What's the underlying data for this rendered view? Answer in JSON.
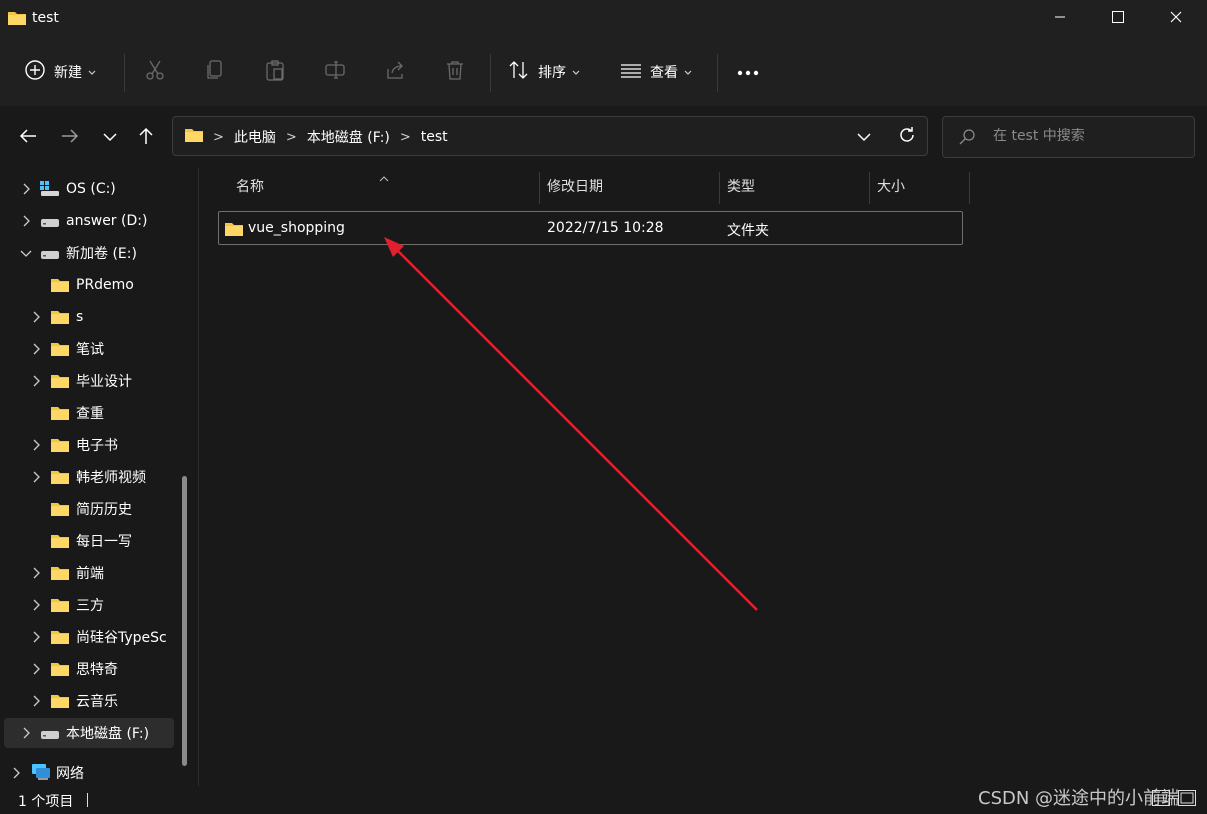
{
  "window": {
    "title": "test",
    "title_icon": "folder-icon"
  },
  "window_controls": {
    "minimize": "minimize-icon",
    "maximize": "maximize-icon",
    "close": "close-icon"
  },
  "toolbar": {
    "new_label": "新建",
    "sort_label": "排序",
    "view_label": "查看",
    "icons": [
      "cut-icon",
      "copy-icon",
      "paste-icon",
      "rename-icon",
      "share-icon",
      "delete-icon",
      "more-icon"
    ]
  },
  "navigation": {
    "back": "back-arrow-icon",
    "forward": "forward-arrow-icon",
    "recent": "chevron-down-icon",
    "up": "up-arrow-icon"
  },
  "address": {
    "crumbs": [
      "此电脑",
      "本地磁盘 (F:)",
      "test"
    ],
    "separator": ">"
  },
  "search": {
    "placeholder": "在 test 中搜索"
  },
  "sidebar": {
    "items": [
      {
        "label": "OS (C:)",
        "icon": "windows-drive-icon"
      },
      {
        "label": "answer (D:)",
        "icon": "drive-icon"
      },
      {
        "label": "新加卷 (E:)",
        "icon": "drive-icon"
      },
      {
        "label": "PRdemo",
        "icon": "folder-icon"
      },
      {
        "label": "s",
        "icon": "folder-icon"
      },
      {
        "label": "笔试",
        "icon": "folder-icon"
      },
      {
        "label": "毕业设计",
        "icon": "folder-icon"
      },
      {
        "label": "查重",
        "icon": "folder-icon"
      },
      {
        "label": "电子书",
        "icon": "folder-icon"
      },
      {
        "label": "韩老师视频",
        "icon": "folder-icon"
      },
      {
        "label": "简历历史",
        "icon": "folder-icon"
      },
      {
        "label": "每日一写",
        "icon": "folder-icon"
      },
      {
        "label": "前端",
        "icon": "folder-icon"
      },
      {
        "label": "三方",
        "icon": "folder-icon"
      },
      {
        "label": "尚硅谷TypeSc",
        "icon": "folder-icon"
      },
      {
        "label": "思特奇",
        "icon": "folder-icon"
      },
      {
        "label": "云音乐",
        "icon": "folder-icon"
      },
      {
        "label": "本地磁盘 (F:)",
        "icon": "drive-icon"
      },
      {
        "label": "网络",
        "icon": "network-icon"
      }
    ]
  },
  "columns": {
    "name": "名称",
    "modified": "修改日期",
    "type": "类型",
    "size": "大小"
  },
  "files": [
    {
      "name": "vue_shopping",
      "modified": "2022/7/15 10:28",
      "type": "文件夹",
      "size": ""
    }
  ],
  "status": {
    "count": "1 个项目"
  },
  "watermark": "CSDN @迷途中的小前端",
  "colors": {
    "background": "#191919",
    "chrome": "#202020",
    "folder": "#f3c34b",
    "annotation_arrow": "#e0202e"
  }
}
